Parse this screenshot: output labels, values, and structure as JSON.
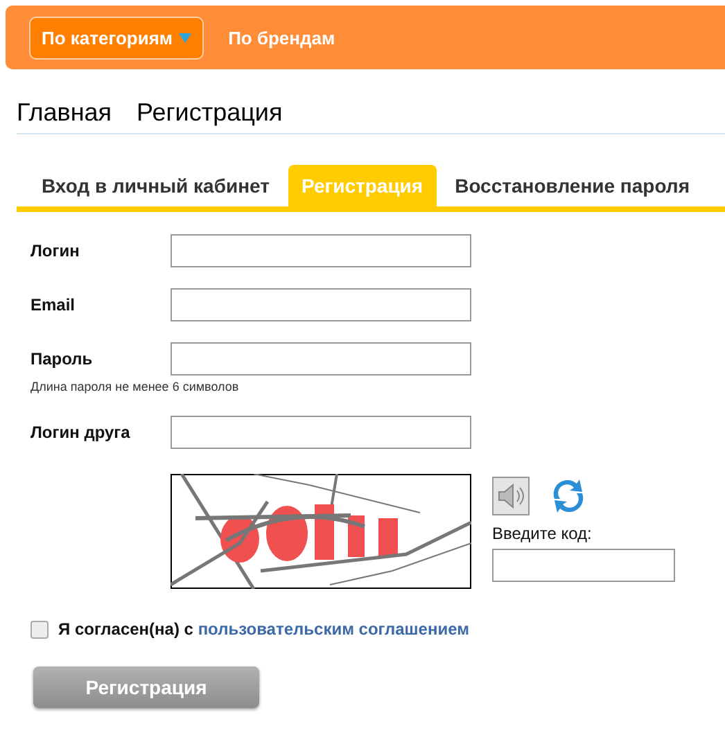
{
  "nav": {
    "items": [
      {
        "label": "По категориям",
        "kind": "dropdown",
        "selected": true
      },
      {
        "label": "По брендам",
        "kind": "link",
        "selected": false
      }
    ]
  },
  "breadcrumb": [
    "Главная",
    "Регистрация"
  ],
  "tabs": [
    {
      "label": "Вход в личный кабинет",
      "selected": false
    },
    {
      "label": "Регистрация",
      "selected": true
    },
    {
      "label": "Восстановление пароля",
      "selected": false
    }
  ],
  "fields": [
    {
      "label": "Логин"
    },
    {
      "label": "Email"
    },
    {
      "label": "Пароль",
      "hint": "Длина пароля не менее 6 символов"
    },
    {
      "label": "Логин друга"
    }
  ],
  "captcha": {
    "code_label": "Введите код:"
  },
  "agreement": {
    "checked": false,
    "text": "Я согласен(на) с",
    "link": "пользовательским соглашением"
  },
  "submit": "Регистрация"
}
